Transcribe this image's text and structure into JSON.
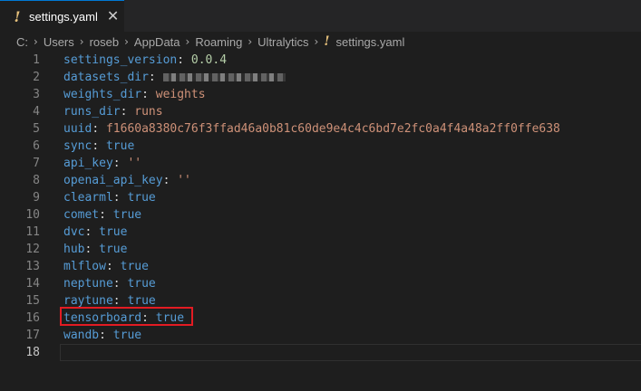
{
  "tab": {
    "label": "settings.yaml",
    "icon": "yaml-file-icon",
    "icon_glyph": "!",
    "close_glyph": "✕"
  },
  "breadcrumb": {
    "items": [
      "C:",
      "Users",
      "roseb",
      "AppData",
      "Roaming",
      "Ultralytics"
    ],
    "file": "settings.yaml",
    "separator": "›"
  },
  "editor": {
    "lines": [
      {
        "n": "1",
        "key": "settings_version",
        "value": "0.0.4",
        "type": "num"
      },
      {
        "n": "2",
        "key": "datasets_dir",
        "value": "",
        "type": "redacted"
      },
      {
        "n": "3",
        "key": "weights_dir",
        "value": "weights",
        "type": "str"
      },
      {
        "n": "4",
        "key": "runs_dir",
        "value": "runs",
        "type": "str"
      },
      {
        "n": "5",
        "key": "uuid",
        "value": "f1660a8380c76f3ffad46a0b81c60de9e4c4c6bd7e2fc0a4f4a48a2ff0ffe638",
        "type": "str"
      },
      {
        "n": "6",
        "key": "sync",
        "value": "true",
        "type": "bool"
      },
      {
        "n": "7",
        "key": "api_key",
        "value": "''",
        "type": "str"
      },
      {
        "n": "8",
        "key": "openai_api_key",
        "value": "''",
        "type": "str"
      },
      {
        "n": "9",
        "key": "clearml",
        "value": "true",
        "type": "bool"
      },
      {
        "n": "10",
        "key": "comet",
        "value": "true",
        "type": "bool"
      },
      {
        "n": "11",
        "key": "dvc",
        "value": "true",
        "type": "bool"
      },
      {
        "n": "12",
        "key": "hub",
        "value": "true",
        "type": "bool"
      },
      {
        "n": "13",
        "key": "mlflow",
        "value": "true",
        "type": "bool"
      },
      {
        "n": "14",
        "key": "neptune",
        "value": "true",
        "type": "bool"
      },
      {
        "n": "15",
        "key": "raytune",
        "value": "true",
        "type": "bool"
      },
      {
        "n": "16",
        "key": "tensorboard",
        "value": "true",
        "type": "bool"
      },
      {
        "n": "17",
        "key": "wandb",
        "value": "true",
        "type": "bool"
      },
      {
        "n": "18",
        "key": "",
        "value": "",
        "type": "empty"
      }
    ],
    "highlighted_key": "tensorboard",
    "current_line": "18"
  },
  "colors": {
    "background": "#1e1e1e",
    "key": "#569cd6",
    "string": "#ce9178",
    "number": "#b5cea8",
    "highlight_box": "#e31b23"
  }
}
